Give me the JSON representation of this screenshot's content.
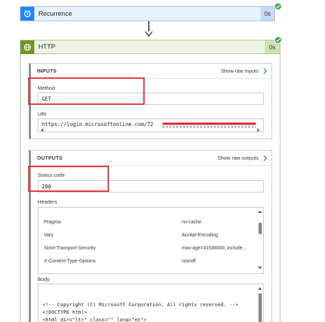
{
  "recurrence": {
    "title": "Recurrence",
    "time": "0s",
    "icon": "alarm-clock-icon",
    "status": "succeeded"
  },
  "http": {
    "title": "HTTP",
    "time": "0s",
    "icon": "globe-icon",
    "status": "succeeded",
    "inputs": {
      "section_title": "INPUTS",
      "show_raw_label": "Show raw inputs",
      "method_label": "Method",
      "method_value": "GET",
      "uri_label": "URI",
      "uri_value": "https://login.microsoftonline.com/72"
    },
    "outputs": {
      "section_title": "OUTPUTS",
      "show_raw_label": "Show raw outputs",
      "status_code_label": "Status code",
      "status_code_value": "200",
      "headers_label": "Headers",
      "headers": [
        {
          "key": "Pragma",
          "value": "no-cache"
        },
        {
          "key": "Vary",
          "value": "Accept-Encoding"
        },
        {
          "key": "Strict-Transport-Security",
          "value": "max-age=31536000; include..."
        },
        {
          "key": "X-Content-Type-Options",
          "value": "nosniff"
        }
      ],
      "body_label": "Body",
      "body_lines": [
        "<!-- Copyright (C) Microsoft Corporation. All rights reserved. -->",
        "<!DOCTYPE html>",
        "<html dir=\"ltr\" class=\"\" lang=\"en\">"
      ]
    }
  },
  "colors": {
    "recurrence_accent": "#1f85ff",
    "http_accent": "#709727",
    "success": "#3ea84a",
    "highlight": "#e53238"
  }
}
